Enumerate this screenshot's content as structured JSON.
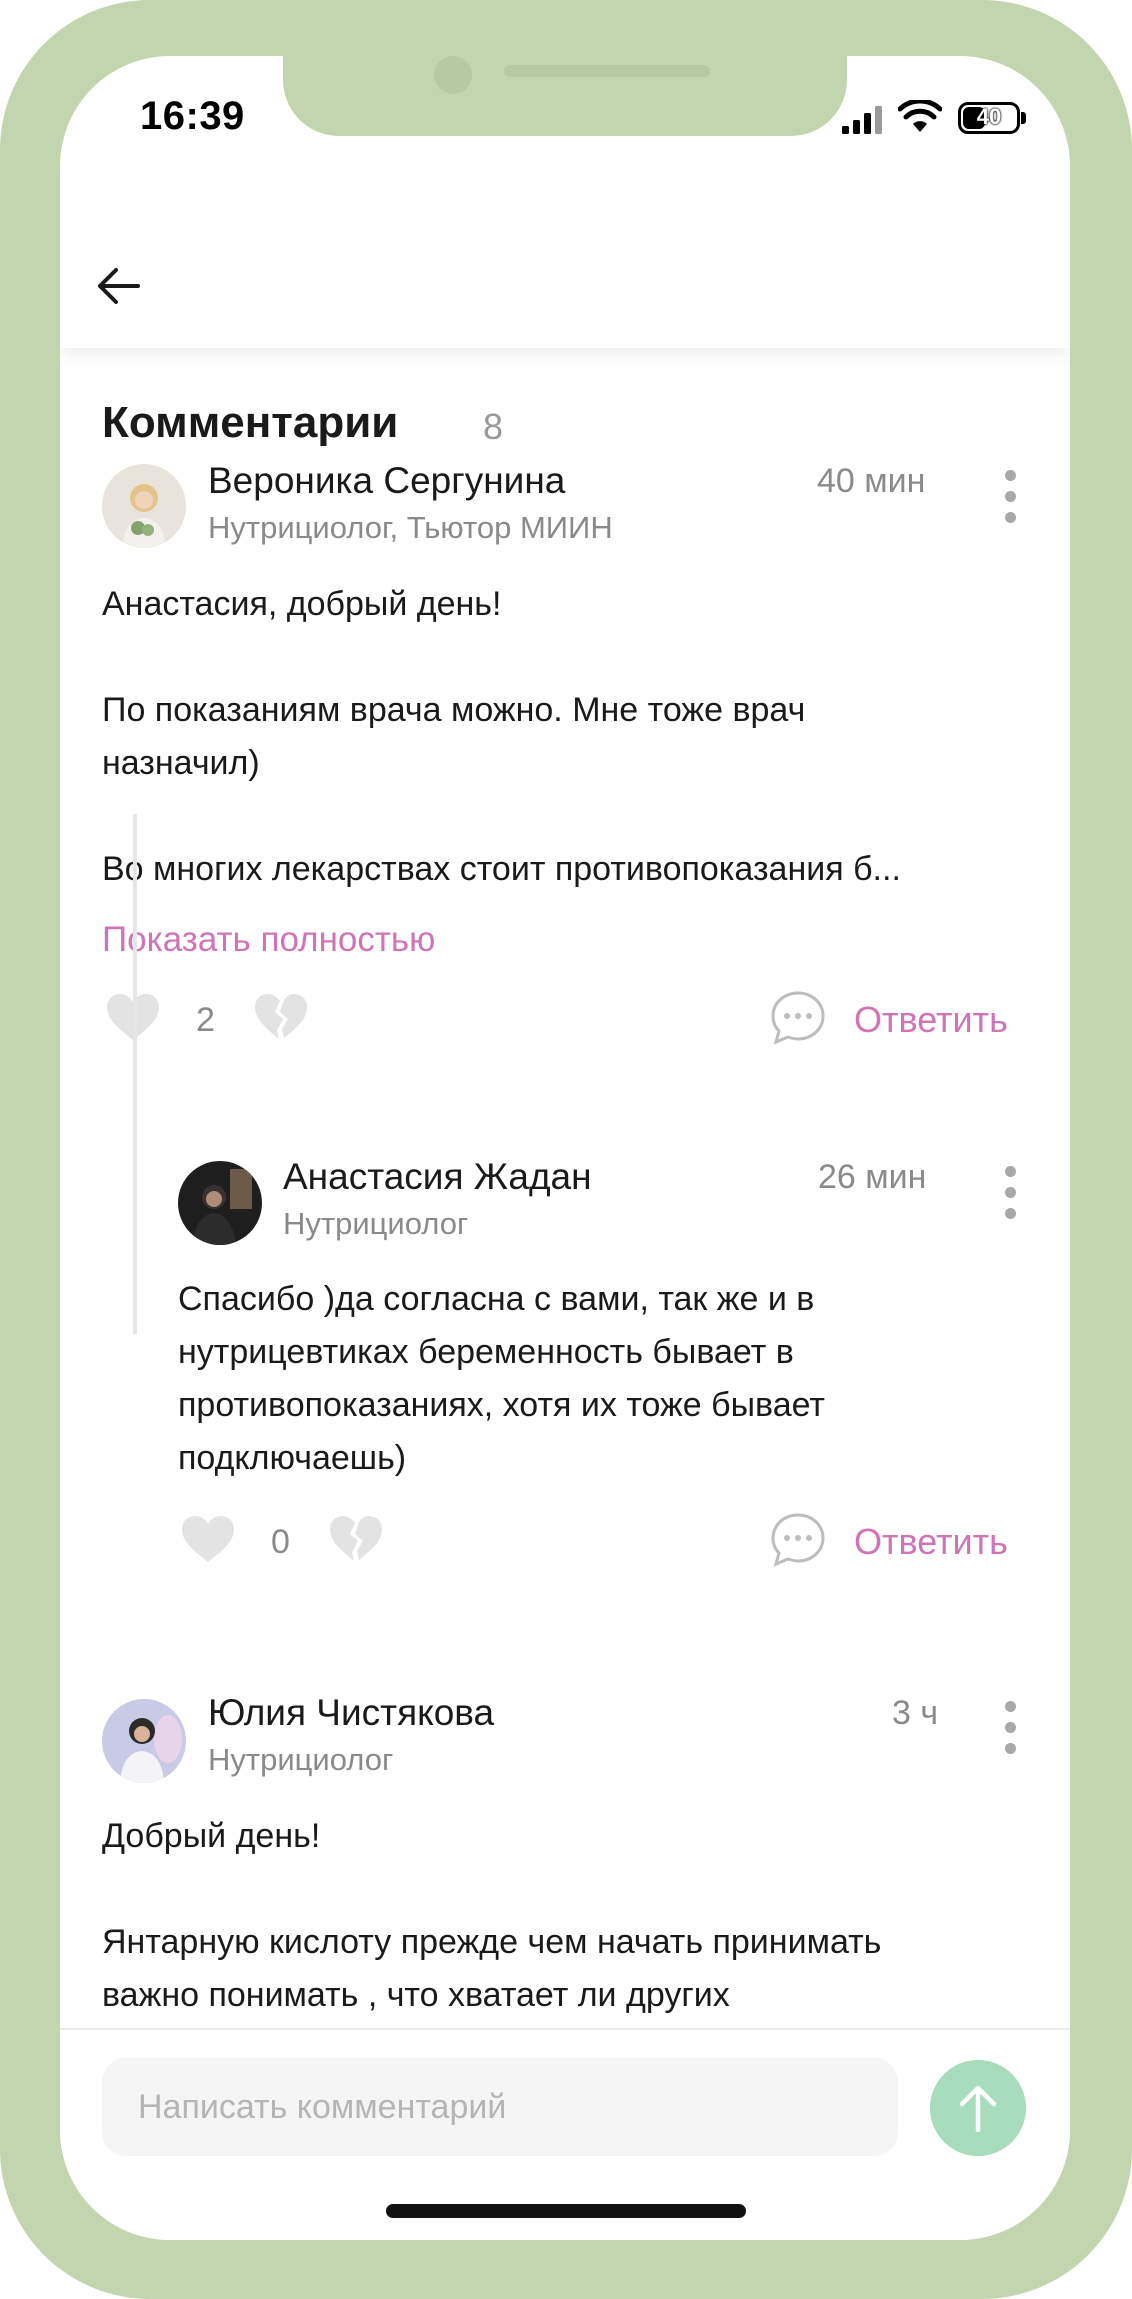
{
  "status_bar": {
    "time": "16:39",
    "battery": "40"
  },
  "header": {
    "title": "Комментарии",
    "count": "8"
  },
  "comments": [
    {
      "author": "Вероника Сергунина",
      "role": "Нутрициолог, Тьютор МИИН",
      "time": "40 мин",
      "lines": [
        "Анастасия, добрый день!",
        "",
        "По показаниям врача можно. Мне тоже врач",
        "назначил)",
        "",
        "Во многих лекарствах стоит противопоказания б..."
      ],
      "show_more": "Показать полностью",
      "likes": "2",
      "reply_label": "Ответить"
    },
    {
      "author": "Анастасия Жадан",
      "role": "Нутрициолог",
      "time": "26 мин",
      "lines": [
        "Спасибо )да согласна с вами, так же и в",
        "нутрицевтиках беременность бывает в",
        "противопоказаниях, хотя их тоже бывает",
        "подключаешь)"
      ],
      "likes": "0",
      "reply_label": "Ответить"
    },
    {
      "author": "Юлия Чистякова",
      "role": "Нутрициолог",
      "time": "3 ч",
      "lines": [
        "Добрый день!",
        "",
        "Янтарную кислоту прежде чем начать принимать",
        "важно понимать , что хватает ли других"
      ]
    }
  ],
  "composer": {
    "placeholder": "Написать комментарий"
  },
  "colors": {
    "frame": "#c2d5ae",
    "accent": "#d174b5",
    "send_button": "#a7dcbc"
  }
}
